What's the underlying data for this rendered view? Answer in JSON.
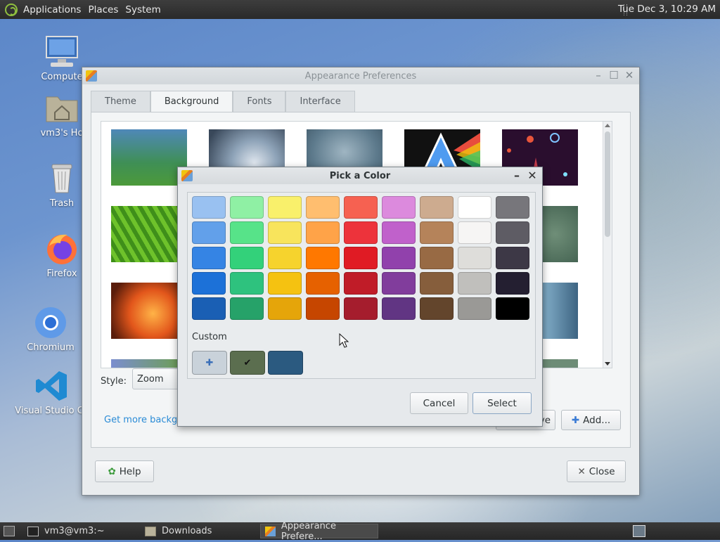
{
  "top_panel": {
    "menus": [
      "Applications",
      "Places",
      "System"
    ],
    "clock": "Tue Dec  3, 10:29 AM"
  },
  "desktop_icons": [
    {
      "label": "Compute",
      "icon": "computer-icon"
    },
    {
      "label": "vm3's Ho",
      "icon": "home-folder-icon"
    },
    {
      "label": "Trash",
      "icon": "trash-icon"
    },
    {
      "label": "Firefox",
      "icon": "firefox-icon"
    },
    {
      "label": "Chromium",
      "icon": "chromium-icon"
    },
    {
      "label": "Visual Studio Co",
      "icon": "vscode-icon"
    }
  ],
  "appearance": {
    "title": "Appearance Preferences",
    "tabs": [
      "Theme",
      "Background",
      "Fonts",
      "Interface"
    ],
    "active_tab": "Background",
    "style_label": "Style:",
    "style_value": "Zoom",
    "link": "Get more backgrounds online",
    "remove_label": "Remove",
    "add_label": "Add...",
    "help_label": "Help",
    "close_label": "Close"
  },
  "color_dialog": {
    "title": "Pick a Color",
    "custom_label": "Custom",
    "cancel_label": "Cancel",
    "select_label": "Select",
    "palette_rows": [
      [
        "#99c1f1",
        "#8ff0a4",
        "#f9f06b",
        "#ffbe6f",
        "#f66151",
        "#dc8add",
        "#cdab8f",
        "#ffffff",
        "#77767b"
      ],
      [
        "#62a0ea",
        "#57e389",
        "#f8e45c",
        "#ffa348",
        "#ed333b",
        "#c061cb",
        "#b5835a",
        "#f6f5f4",
        "#5e5c64"
      ],
      [
        "#3584e4",
        "#33d17a",
        "#f6d32d",
        "#ff7800",
        "#e01b24",
        "#9141ac",
        "#986a44",
        "#deddda",
        "#3d3846"
      ],
      [
        "#1c71d8",
        "#2ec27e",
        "#f5c211",
        "#e66100",
        "#c01c28",
        "#813d9c",
        "#865e3c",
        "#c0bfbc",
        "#241f31"
      ],
      [
        "#1a5fb4",
        "#26a269",
        "#e5a50a",
        "#c64600",
        "#a51d2d",
        "#613583",
        "#63452c",
        "#9a9996",
        "#000000"
      ]
    ],
    "custom_swatches": [
      "#c9d2da",
      "#5b6e4f",
      "#2b5a80"
    ]
  },
  "taskbar": {
    "items": [
      "vm3@vm3:~",
      "Downloads",
      "Appearance Prefere..."
    ]
  }
}
